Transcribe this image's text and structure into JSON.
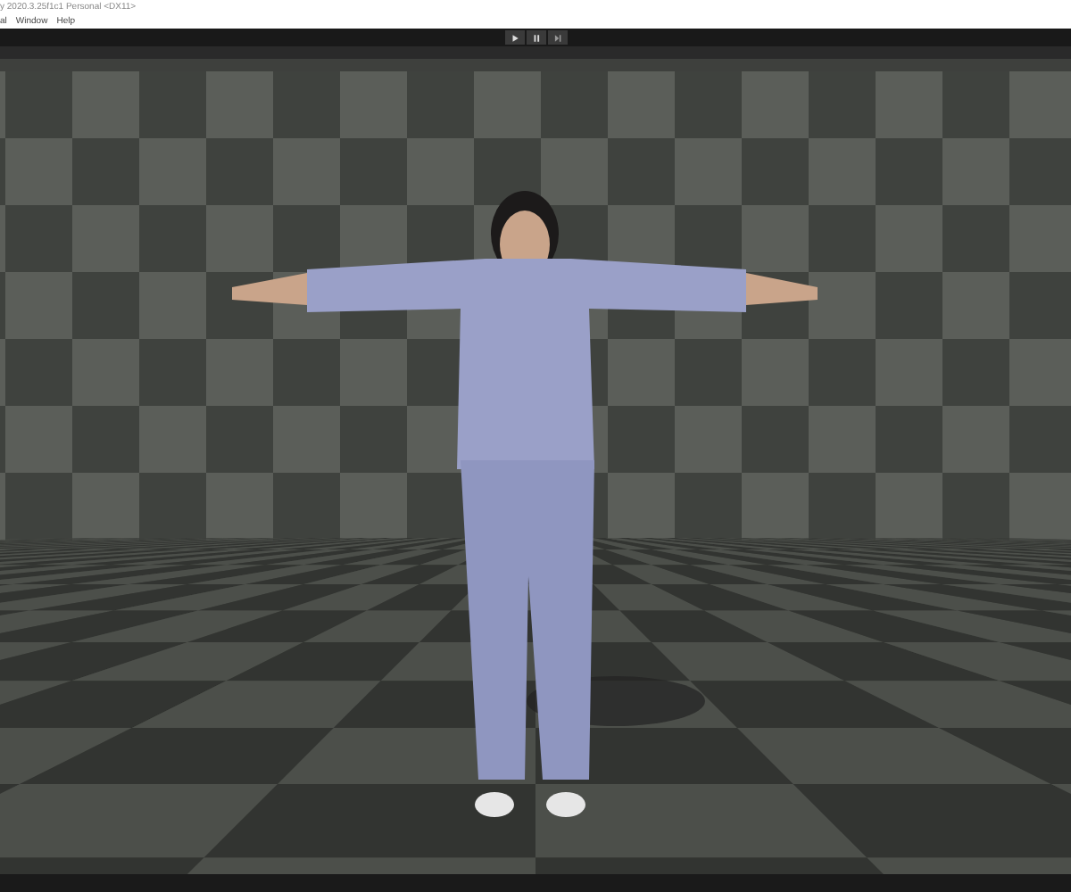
{
  "window": {
    "title": "y 2020.3.25f1c1 Personal <DX11>"
  },
  "menu": [
    "al",
    "Window",
    "Help"
  ],
  "toolbar": {
    "buttons": [
      {
        "kind": "play",
        "selected": false
      },
      {
        "kind": "pause",
        "selected": false
      },
      {
        "kind": "step",
        "selected": false
      }
    ]
  }
}
